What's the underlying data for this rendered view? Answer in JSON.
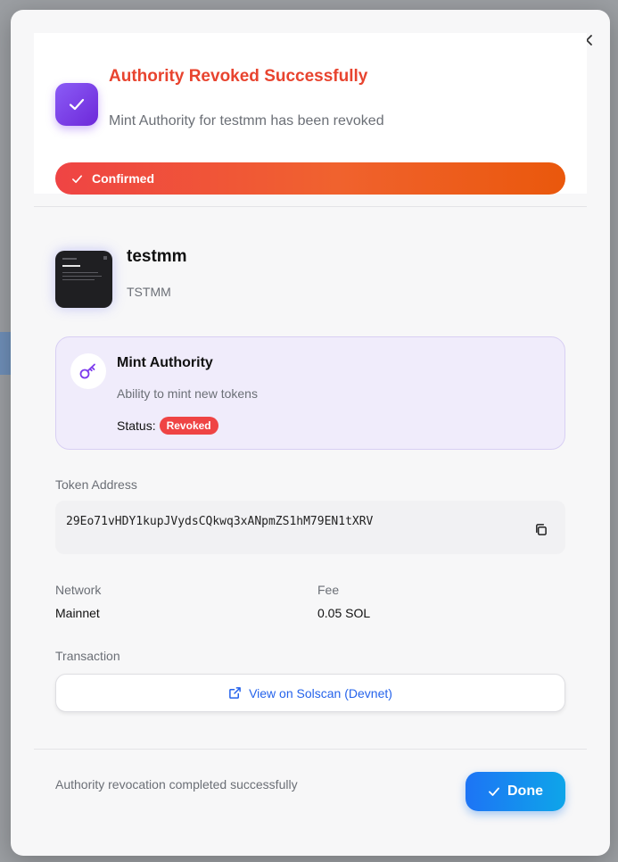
{
  "header": {
    "title": "Authority Revoked Successfully",
    "subtitle": "Mint Authority for testmm has been revoked",
    "status_bar_label": "Confirmed"
  },
  "token": {
    "name": "testmm",
    "symbol": "TSTMM"
  },
  "authority": {
    "title": "Mint Authority",
    "description": "Ability to mint new tokens",
    "status_label": "Status:",
    "status_value": "Revoked"
  },
  "address": {
    "label": "Token Address",
    "value": "29Eo71vHDY1kupJVydsCQkwq3xANpmZS1hM79EN1tXRV"
  },
  "details": {
    "network_label": "Network",
    "network_value": "Mainnet",
    "fee_label": "Fee",
    "fee_value": "0.05 SOL"
  },
  "transaction": {
    "label": "Transaction",
    "link_label": "View on Solscan (Devnet)"
  },
  "footer": {
    "message": "Authority revocation completed successfully",
    "done_label": "Done"
  },
  "colors": {
    "title_red": "#e8442f",
    "purple": "#7c3aed",
    "revoked_red": "#ef4444",
    "link_blue": "#2563eb",
    "done_blue": "#1d74f5"
  },
  "icons": {
    "close": "close-icon",
    "check": "check-icon",
    "key": "key-icon",
    "copy": "copy-icon",
    "external_link": "external-link-icon"
  }
}
